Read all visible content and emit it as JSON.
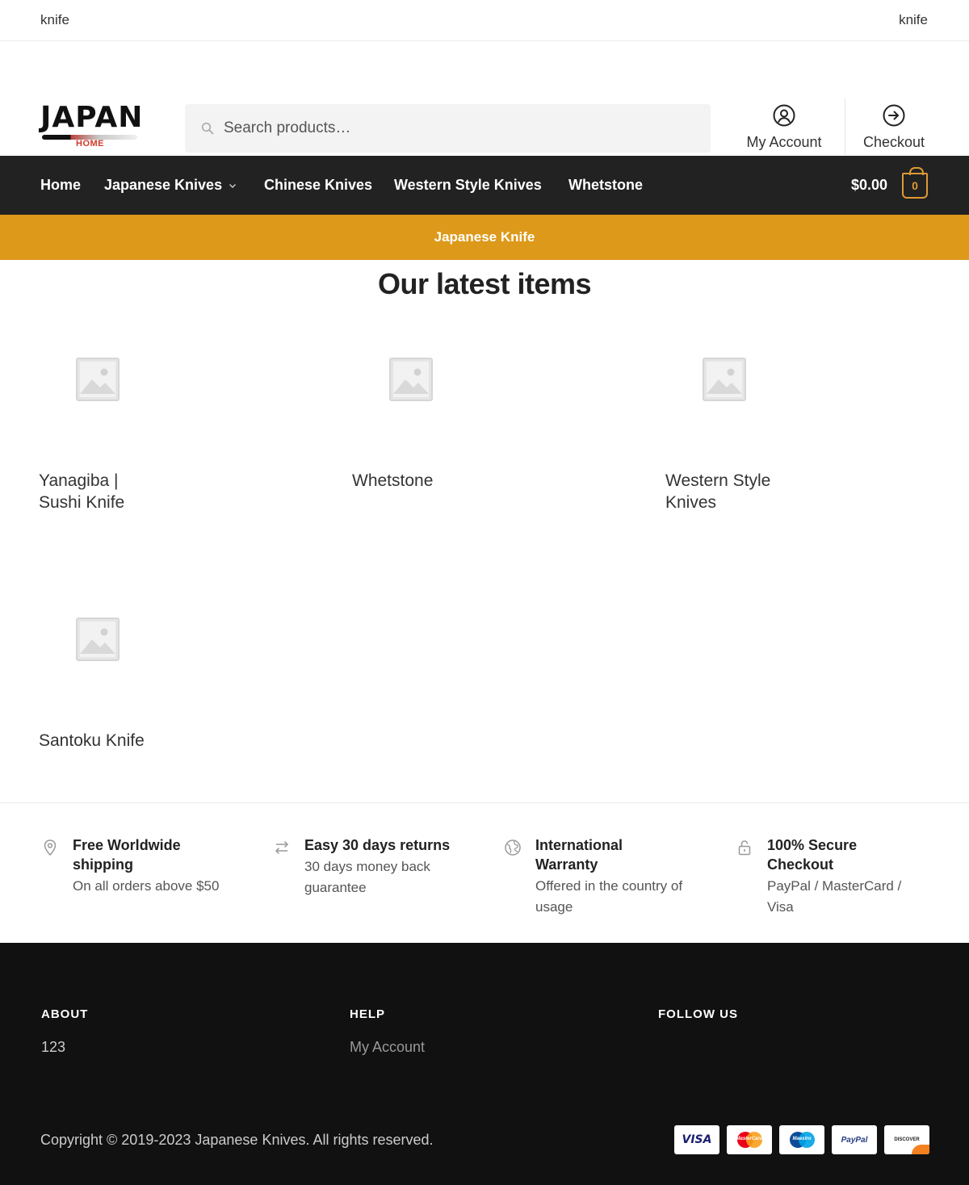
{
  "topbar": {
    "left_text": "knife",
    "right_text": "knife"
  },
  "logo": {
    "word": "JAPAN",
    "sub": "HOME"
  },
  "search": {
    "placeholder": "Search products…",
    "icon": "search-icon"
  },
  "header_links": [
    {
      "label": "My Account",
      "icon": "user-circle-icon"
    },
    {
      "label": "Checkout",
      "icon": "arrow-right-circle-icon"
    }
  ],
  "nav": {
    "items": [
      {
        "label": "Home"
      },
      {
        "label": "Japanese Knives",
        "has_dropdown": true
      },
      {
        "label": "Chinese Knives"
      },
      {
        "label": "Western Style Knives"
      },
      {
        "label": "Whetstone"
      }
    ],
    "cart_total": "$0.00",
    "cart_count": "0"
  },
  "banner": {
    "text": "Japanese Knife"
  },
  "section": {
    "title": "Our latest items"
  },
  "products": [
    {
      "name": "Yanagiba | Sushi Knife"
    },
    {
      "name": "Whetstone"
    },
    {
      "name": "Western Style Knives"
    },
    {
      "name": "Santoku Knife"
    }
  ],
  "features": [
    {
      "icon": "location-pin-icon",
      "title": "Free Worldwide shipping",
      "desc": "On all orders above $50"
    },
    {
      "icon": "exchange-arrows-icon",
      "title": "Easy 30 days returns",
      "desc": "30 days money back guarantee"
    },
    {
      "icon": "globe-icon",
      "title": "International Warranty",
      "desc": "Offered in the country of usage"
    },
    {
      "icon": "lock-icon",
      "title": "100% Secure Checkout",
      "desc": "PayPal / MasterCard / Visa"
    }
  ],
  "footer": {
    "about": {
      "heading": "ABOUT",
      "text": "123"
    },
    "help": {
      "heading": "HELP",
      "link": "My Account"
    },
    "follow": {
      "heading": "FOLLOW US"
    },
    "copyright": "Copyright © 2019-2023 Japanese Knives.  All rights reserved.",
    "payments": {
      "visa": "VISA",
      "mastercard": "MasterCard",
      "maestro": "Maestro",
      "paypal": "PayPal",
      "discover": "DISCOVER"
    }
  },
  "colors": {
    "accent": "#dd9919",
    "nav_bg": "#222222",
    "footer_bg": "#111111"
  }
}
